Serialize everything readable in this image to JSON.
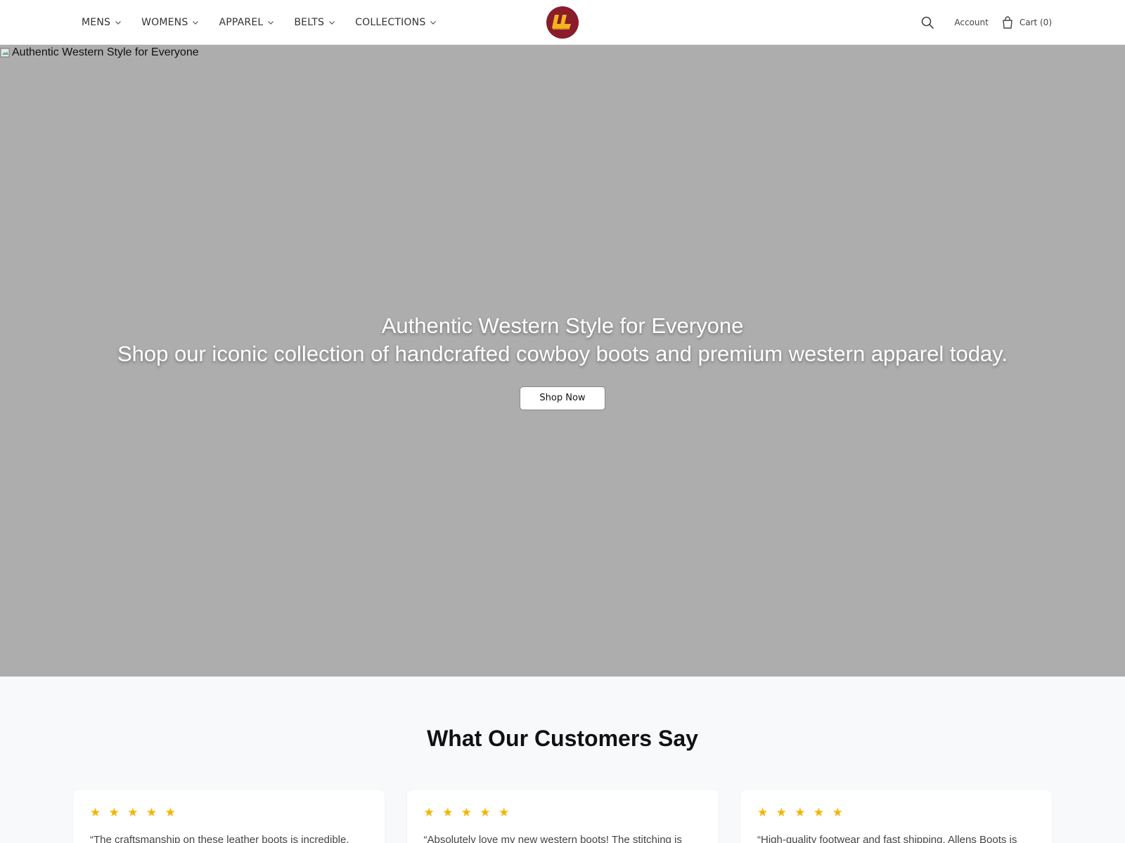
{
  "header": {
    "nav": [
      {
        "label": "MENS"
      },
      {
        "label": "WOMENS"
      },
      {
        "label": "APPAREL"
      },
      {
        "label": "BELTS"
      },
      {
        "label": "COLLECTIONS"
      }
    ],
    "logo_icon": "boots-logo-icon",
    "account_label": "Account",
    "cart_label": "Cart (0)",
    "search_icon": "search-icon",
    "cart_icon": "shopping-bag-icon",
    "colors": {
      "logo_bg": "#8a1c2b",
      "logo_mark": "#f2b51d"
    }
  },
  "hero": {
    "image_alt": "Authentic Western Style for Everyone",
    "title": "Authentic Western Style for Everyone",
    "subtitle": "Shop our iconic collection of handcrafted cowboy boots and premium western apparel today.",
    "cta_label": "Shop Now",
    "bg_color": "#adadad"
  },
  "reviews": {
    "title": "What Our Customers Say",
    "star_color": "#f5b400",
    "items": [
      {
        "stars": "★ ★ ★ ★ ★",
        "rating": 5,
        "quote": "“The craftsmanship on these leather boots is incredible."
      },
      {
        "stars": "★ ★ ★ ★ ★",
        "rating": 5,
        "quote": "“Absolutely love my new western boots! The stitching is"
      },
      {
        "stars": "★ ★ ★ ★ ★",
        "rating": 5,
        "quote": "“High-quality footwear and fast shipping. Allens Boots is"
      }
    ]
  }
}
